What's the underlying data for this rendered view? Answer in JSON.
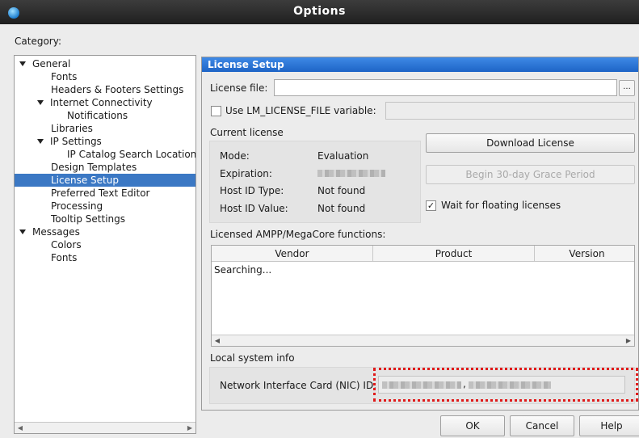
{
  "window": {
    "title": "Options"
  },
  "category": {
    "label": "Category:",
    "tree": [
      {
        "label": "General",
        "expanded": true
      },
      {
        "label": "Fonts"
      },
      {
        "label": "Headers & Footers Settings"
      },
      {
        "label": "Internet Connectivity",
        "expanded": true
      },
      {
        "label": "Notifications"
      },
      {
        "label": "Libraries"
      },
      {
        "label": "IP Settings",
        "expanded": true
      },
      {
        "label": "IP Catalog Search Location"
      },
      {
        "label": "Design Templates"
      },
      {
        "label": "License Setup",
        "selected": true
      },
      {
        "label": "Preferred Text Editor"
      },
      {
        "label": "Processing"
      },
      {
        "label": "Tooltip Settings"
      },
      {
        "label": "Messages",
        "expanded": true
      },
      {
        "label": "Colors"
      },
      {
        "label": "Fonts"
      }
    ]
  },
  "panel": {
    "header": "License Setup",
    "license_file": {
      "label": "License file:",
      "value": "",
      "browse_label": "..."
    },
    "lm_license": {
      "label": "Use LM_LICENSE_FILE variable:",
      "checked": false,
      "value": ""
    },
    "current_license": {
      "title": "Current license",
      "rows": [
        {
          "label": "Mode:",
          "value": "Evaluation"
        },
        {
          "label": "Expiration:",
          "value": ""
        },
        {
          "label": "Host ID Type:",
          "value": "Not found"
        },
        {
          "label": "Host ID Value:",
          "value": "Not found"
        }
      ]
    },
    "buttons": {
      "download": "Download License",
      "grace": "Begin 30-day Grace Period"
    },
    "wait_floating": {
      "label": "Wait for floating licenses",
      "checked": true
    },
    "ampp": {
      "title": "Licensed AMPP/MegaCore functions:",
      "columns": [
        "Vendor",
        "Product",
        "Version"
      ],
      "status": "Searching..."
    },
    "local_info": {
      "title": "Local system info",
      "nic_label": "Network Interface Card (NIC) ID:",
      "nic_separator": ","
    }
  },
  "footer": {
    "ok": "OK",
    "cancel": "Cancel",
    "help": "Help"
  },
  "colors": {
    "selection": "#3b78c4",
    "header": "#1d64c6",
    "highlight": "#e01a1a"
  }
}
